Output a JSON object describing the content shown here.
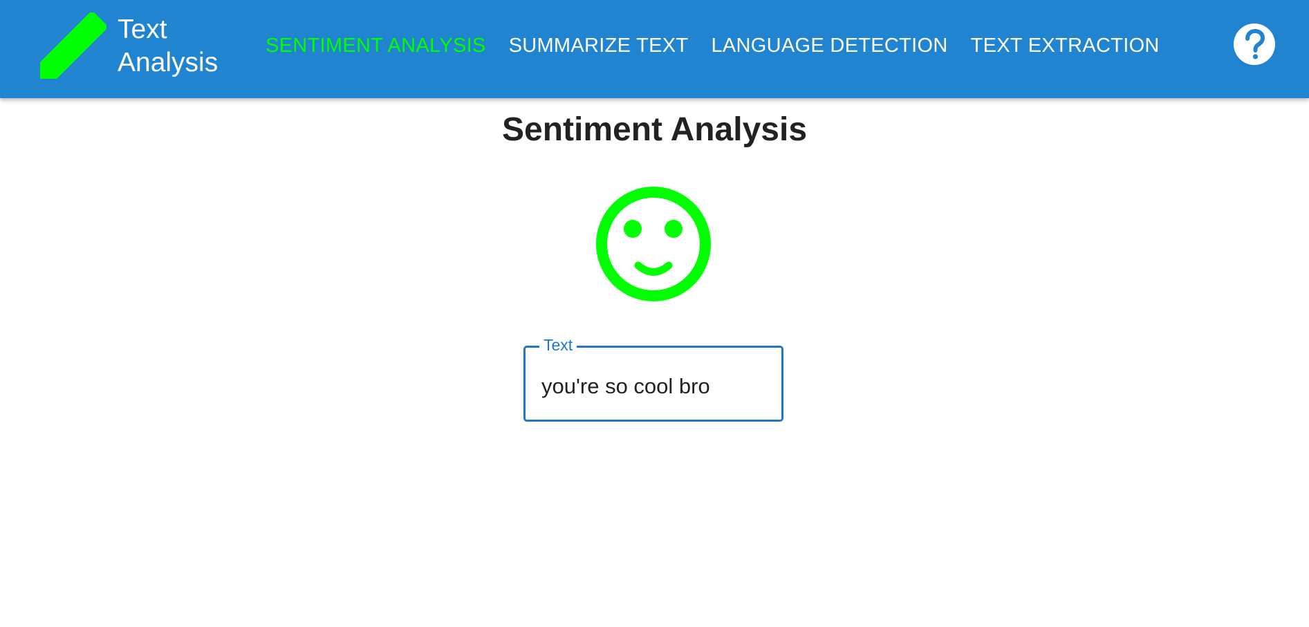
{
  "colors": {
    "appbar": "#2184d0",
    "accent_active": "#00ff00",
    "sentiment_positive": "#00ff00",
    "field_focus": "#1f77d0"
  },
  "brand": {
    "icon": "pencil-icon",
    "title_line1": "Text",
    "title_line2": "Analysis"
  },
  "nav": {
    "items": [
      {
        "label": "SENTIMENT ANALYSIS",
        "active": true
      },
      {
        "label": "SUMMARIZE TEXT",
        "active": false
      },
      {
        "label": "LANGUAGE DETECTION",
        "active": false
      },
      {
        "label": "TEXT EXTRACTION",
        "active": false
      }
    ]
  },
  "help": {
    "icon": "help-circle-icon"
  },
  "main": {
    "title": "Sentiment Analysis",
    "sentiment_icon": "smiley-face-icon",
    "text_field": {
      "label": "Text",
      "value": "you're so cool bro"
    }
  }
}
